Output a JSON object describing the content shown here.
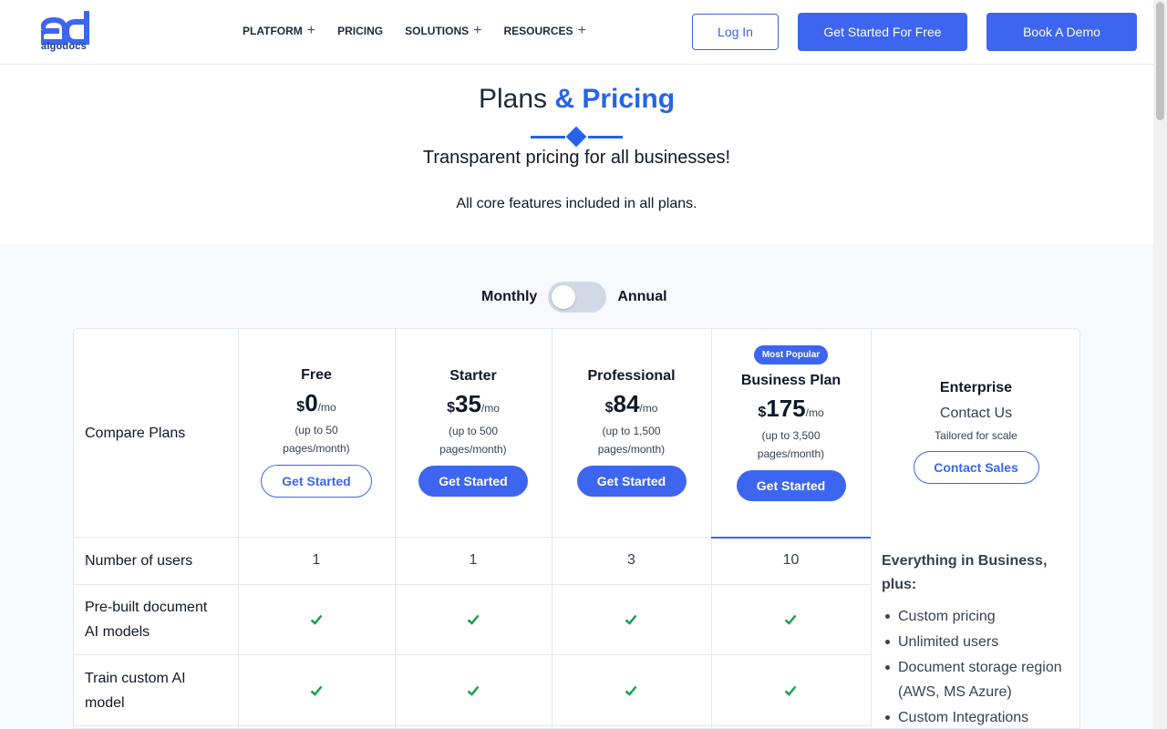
{
  "brand": {
    "name": "algodocs",
    "color": "#3d65f0"
  },
  "nav": {
    "items": [
      {
        "label": "PLATFORM",
        "expandable": true
      },
      {
        "label": "PRICING",
        "expandable": false
      },
      {
        "label": "SOLUTIONS",
        "expandable": true
      },
      {
        "label": "RESOURCES",
        "expandable": true
      }
    ],
    "plus_glyph": "+",
    "login_label": "Log In",
    "get_started_label": "Get Started For Free",
    "demo_label": "Book A Demo"
  },
  "hero": {
    "title_plain": "Plans",
    "title_accent": "& Pricing",
    "subtitle": "Transparent pricing for all businesses!",
    "note": "All core features included in all plans."
  },
  "billing_toggle": {
    "left_label": "Monthly",
    "right_label": "Annual",
    "selected": "Monthly"
  },
  "table": {
    "compare_label": "Compare Plans",
    "plans": [
      {
        "name": "Free",
        "currency": "$",
        "price": "0",
        "per": "/mo",
        "limit_line1": "(up to 50",
        "limit_line2": "pages/month)",
        "button": "Get Started",
        "style": "outline"
      },
      {
        "name": "Starter",
        "currency": "$",
        "price": "35",
        "per": "/mo",
        "limit_line1": "(up to 500",
        "limit_line2": "pages/month)",
        "button": "Get Started",
        "style": "solid"
      },
      {
        "name": "Professional",
        "currency": "$",
        "price": "84",
        "per": "/mo",
        "limit_line1": "(up to 1,500",
        "limit_line2": "pages/month)",
        "button": "Get Started",
        "style": "solid"
      },
      {
        "name": "Business Plan",
        "badge": "Most Popular",
        "currency": "$",
        "price": "175",
        "per": "/mo",
        "limit_line1": "(up to 3,500",
        "limit_line2": "pages/month)",
        "button": "Get Started",
        "style": "solid"
      }
    ],
    "enterprise": {
      "name": "Enterprise",
      "price_label": "Contact Us",
      "tagline": "Tailored for scale",
      "button": "Contact Sales",
      "features_heading": "Everything in Business, plus:",
      "features": [
        "Custom pricing",
        "Unlimited users",
        "Document storage region (AWS, MS Azure)",
        "Custom Integrations"
      ]
    },
    "rows": [
      {
        "label_line1": "Number of users",
        "label_line2": "",
        "values": [
          "1",
          "1",
          "3",
          "10"
        ]
      },
      {
        "label_line1": "Pre-built document",
        "label_line2": "AI models",
        "values": [
          "check",
          "check",
          "check",
          "check"
        ]
      },
      {
        "label_line1": "Train custom AI",
        "label_line2": "model",
        "values": [
          "check",
          "check",
          "check",
          "check"
        ]
      }
    ],
    "check_color": "#16a34a"
  }
}
